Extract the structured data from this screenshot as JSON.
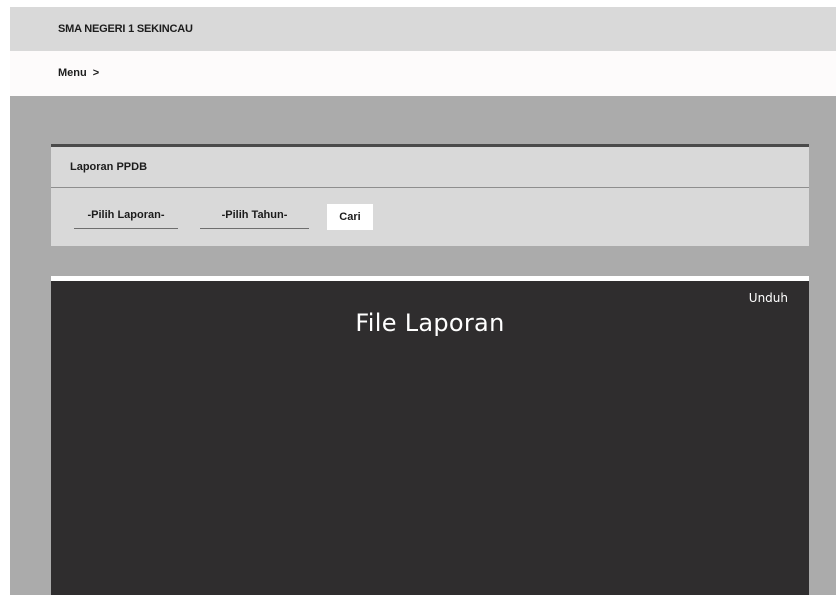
{
  "header": {
    "school_name": "SMA NEGERI 1 SEKINCAU"
  },
  "breadcrumb": {
    "menu_label": "Menu",
    "separator": ">"
  },
  "report_panel": {
    "title": "Laporan PPDB",
    "select_report_label": "-Pilih Laporan-",
    "select_year_label": "-Pilih Tahun-",
    "search_label": "Cari"
  },
  "viewer": {
    "title": "File Laporan",
    "download_label": "Unduh"
  },
  "colors": {
    "background": "#ababab",
    "topbar": "#d9d9d9",
    "menubar": "#fdfbfb",
    "panel": "#d9d9d9",
    "viewer": "#2f2d2e"
  }
}
